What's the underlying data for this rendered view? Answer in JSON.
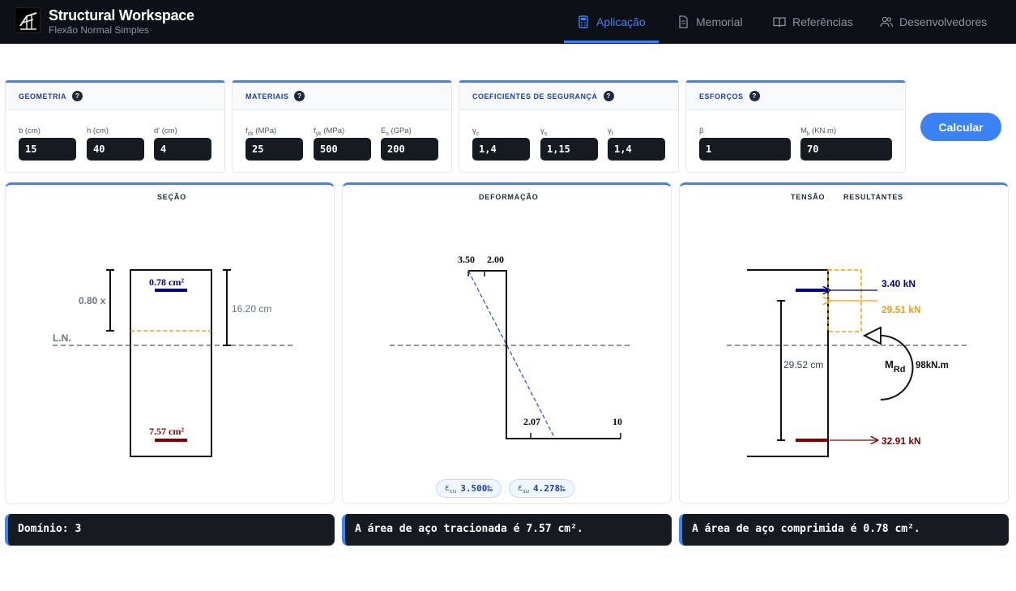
{
  "header": {
    "title": "Structural Workspace",
    "subtitle": "Flexão Normal Simples",
    "nav": [
      {
        "label": "Aplicação",
        "icon": "calculator-icon",
        "active": true
      },
      {
        "label": "Memorial",
        "icon": "document-icon",
        "active": false
      },
      {
        "label": "Referências",
        "icon": "book-icon",
        "active": false
      },
      {
        "label": "Desenvolvedores",
        "icon": "users-icon",
        "active": false
      }
    ]
  },
  "inputs": {
    "geometria": {
      "title": "GEOMETRIA",
      "fields": [
        {
          "label": "b (cm)",
          "value": "15"
        },
        {
          "label": "h (cm)",
          "value": "40"
        },
        {
          "label": "d' (cm)",
          "value": "4"
        }
      ]
    },
    "materiais": {
      "title": "MATERIAIS",
      "fields": [
        {
          "label": "f",
          "sub": "ck",
          "unit": " (MPa)",
          "value": "25"
        },
        {
          "label": "f",
          "sub": "yk",
          "unit": " (MPa)",
          "value": "500"
        },
        {
          "label": "E",
          "sub": "s",
          "unit": " (GPa)",
          "value": "200"
        }
      ]
    },
    "coeficientes": {
      "title": "COEFICIENTES DE SEGURANÇA",
      "fields": [
        {
          "label": "γ",
          "sub": "c",
          "unit": "",
          "value": "1,4"
        },
        {
          "label": "γ",
          "sub": "s",
          "unit": "",
          "value": "1,15"
        },
        {
          "label": "γ",
          "sub": "f",
          "unit": "",
          "value": "1,4"
        }
      ]
    },
    "esforcos": {
      "title": "ESFORÇOS",
      "fields": [
        {
          "label": "β",
          "sub": "",
          "unit": "",
          "value": "1"
        },
        {
          "label": "M",
          "sub": "k",
          "unit": " (KN.m)",
          "value": "70"
        }
      ]
    },
    "calculate_label": "Calcular"
  },
  "secao": {
    "title": "SEÇÃO",
    "top_steel": "0.78 cm²",
    "bottom_steel": "7.57 cm²",
    "x_label": "0.80 x",
    "ln_label": "L.N.",
    "depth_label": "16.20 cm",
    "colors": {
      "compression_steel": "#000080",
      "tension_steel": "#800000",
      "compression_zone": "#f59e0b"
    }
  },
  "deformacao": {
    "title": "DEFORMAÇÃO",
    "top_left": "3.50",
    "top_right": "2.00",
    "bottom_left": "2.07",
    "bottom_right": "10",
    "ecu": {
      "symbol": "ε",
      "sub": "cu",
      "value": "3.500‰"
    },
    "esu": {
      "symbol": "ε",
      "sub": "su",
      "value": "4.278‰"
    }
  },
  "tensao": {
    "title_left": "TENSÃO",
    "title_right": "RESULTANTES",
    "force_top_steel": "3.40 kN",
    "force_concrete": "29.51 kN",
    "force_bottom_steel": "32.91 kN",
    "lever_arm": "29.52 cm",
    "moment_symbol": "M",
    "moment_sub": "Rd",
    "moment_value": "98kN.m"
  },
  "results": {
    "dominio": "Domínio: 3",
    "tracionada": "A área de aço tracionada é 7.57 cm².",
    "comprimida": "A área de aço comprimida é 0.78 cm²."
  }
}
